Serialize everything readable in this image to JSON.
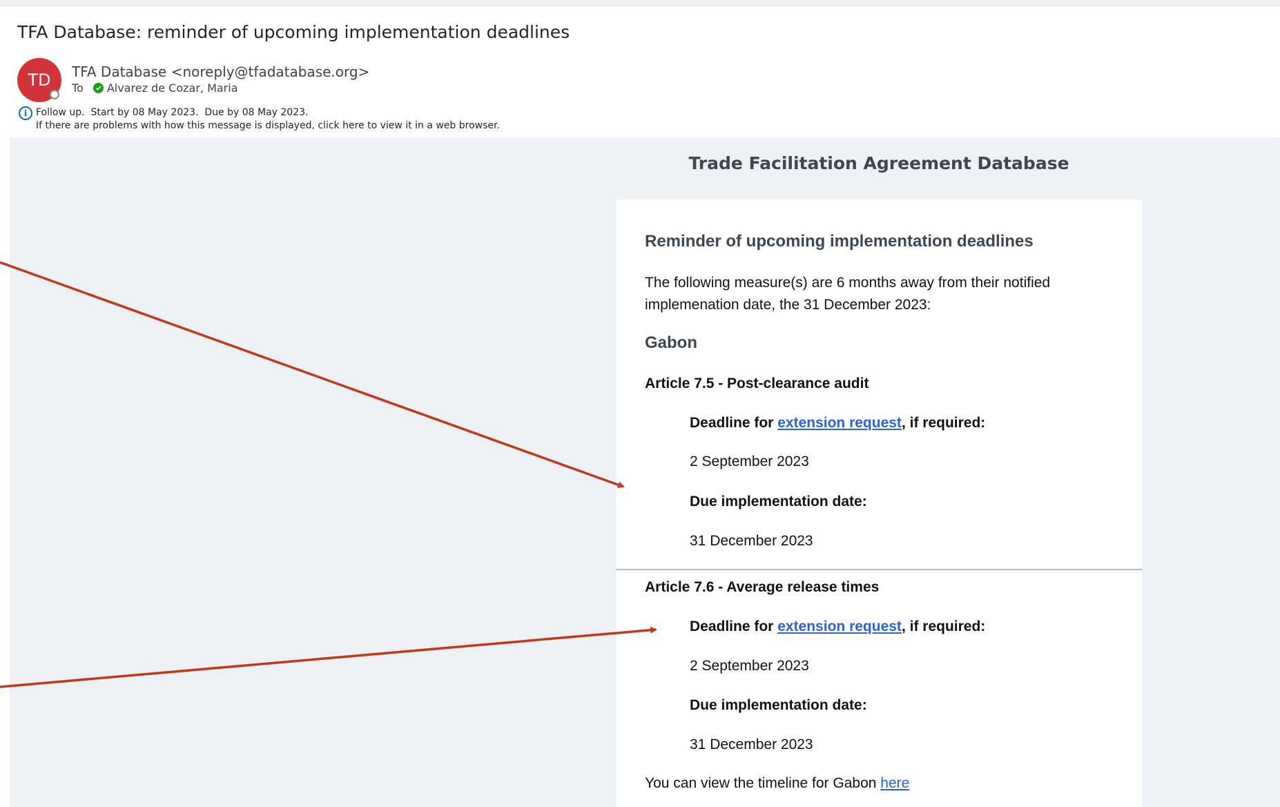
{
  "header": {
    "subject": "TFA Database: reminder of upcoming implementation deadlines",
    "avatar_initials": "TD",
    "sender": "TFA Database <noreply@tfadatabase.org>",
    "to_label": "To",
    "recipient": "Alvarez de Cozar, Maria",
    "follow_up": "Follow up.  Start by 08 May 2023.  Due by 08 May 2023.",
    "display_problem": "If there are problems with how this message is displayed, click here to view it in a web browser."
  },
  "email": {
    "site_title": "Trade Facilitation Agreement Database",
    "heading": "Reminder of upcoming implementation deadlines",
    "intro": "The following measure(s) are 6 months away from their notified implemenation date, the 31 December 2023:",
    "country": "Gabon",
    "articles": [
      {
        "title": "Article 7.5 - Post-clearance audit",
        "deadline_prefix": "Deadline for ",
        "deadline_link": "extension request",
        "deadline_suffix": ", if required:",
        "deadline_date": "2 September 2023",
        "due_label": "Due implementation date:",
        "due_date": "31 December 2023"
      },
      {
        "title": "Article 7.6 - Average release times",
        "deadline_prefix": "Deadline for ",
        "deadline_link": "extension request",
        "deadline_suffix": ", if required:",
        "deadline_date": "2 September 2023",
        "due_label": "Due implementation date:",
        "due_date": "31 December 2023"
      }
    ],
    "footer_text": "You can view the timeline for Gabon ",
    "footer_link": "here"
  },
  "colors": {
    "avatar": "#d13438",
    "link": "#2a62d9",
    "arrow": "#c0391b",
    "body_bg": "#edf1f5"
  }
}
